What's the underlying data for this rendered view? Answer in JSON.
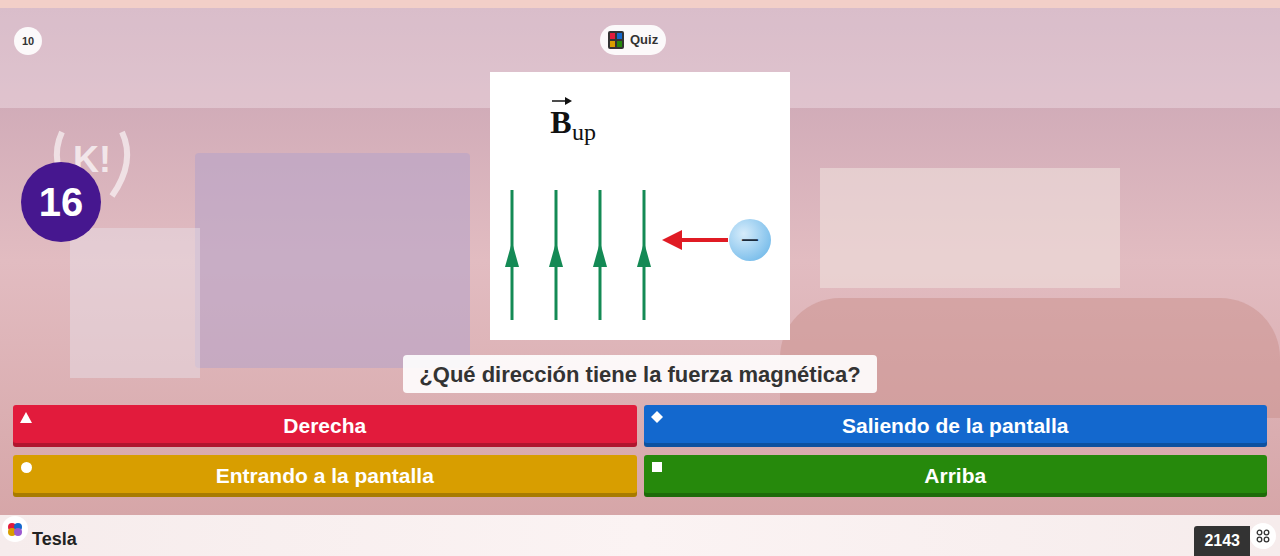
{
  "header": {
    "question_count": "10",
    "mode_label": "Quiz",
    "logo": "K!"
  },
  "timer": "16",
  "figure": {
    "field_label": "B",
    "field_subscript": "up",
    "charge_sign": "—"
  },
  "question": "¿Qué dirección tiene la fuerza magnética?",
  "answers": [
    {
      "kind": "triangle",
      "label": "Derecha",
      "color": "#e21b3c"
    },
    {
      "kind": "diamond",
      "label": "Saliendo de la pantalla",
      "color": "#1368ce"
    },
    {
      "kind": "circle",
      "label": "Entrando a la pantalla",
      "color": "#d89e00"
    },
    {
      "kind": "square",
      "label": "Arriba",
      "color": "#26890c"
    }
  ],
  "footer": {
    "player": "Tesla",
    "score": "2143"
  }
}
